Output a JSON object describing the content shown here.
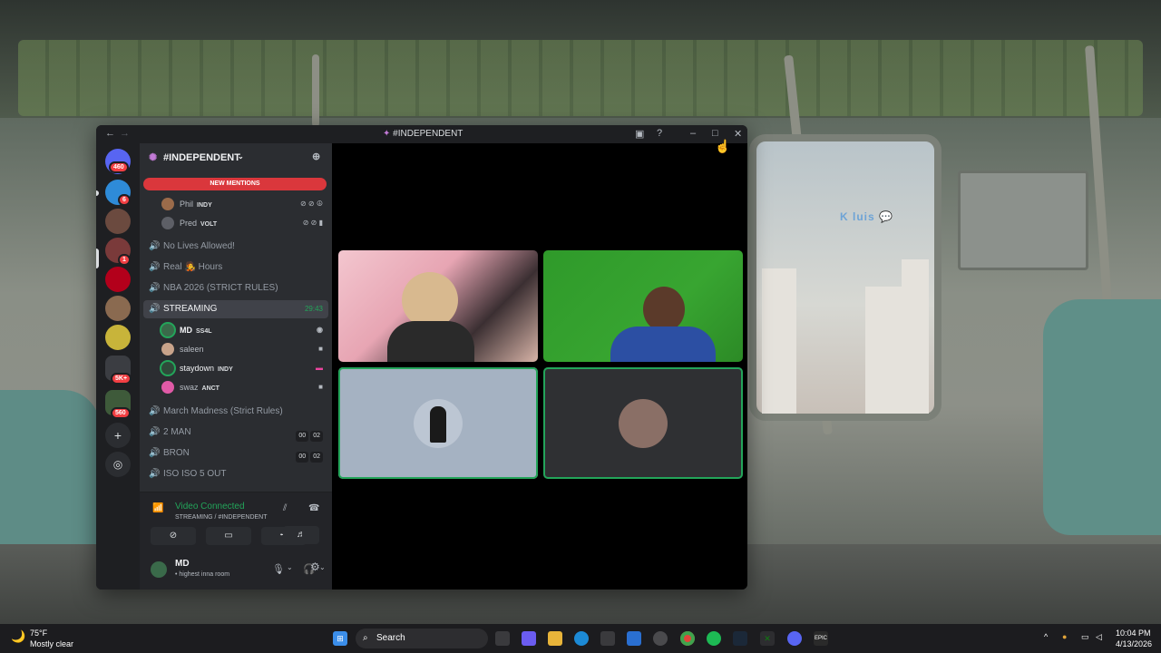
{
  "wallpaper_overlay": "luis",
  "window": {
    "title": "#INDEPENDENT",
    "back": "←",
    "forward": "→"
  },
  "rail": {
    "badges": [
      "460",
      "6",
      "1",
      "5K+",
      "560"
    ]
  },
  "server": {
    "name": "#INDEPENDENT",
    "new_mentions": "NEW MENTIONS"
  },
  "top_users": [
    {
      "name": "Phil",
      "tag": "INDY"
    },
    {
      "name": "Pred",
      "tag": "VOLT"
    }
  ],
  "channels_before": [
    {
      "name": "No Lives Allowed!"
    },
    {
      "name": "Real",
      "name_after": "Hours"
    },
    {
      "name": "NBA 2026 (STRICT RULES)"
    }
  ],
  "active_channel": {
    "name": "STREAMING",
    "timer": "29:43",
    "users": [
      {
        "name": "MD",
        "tag": "SS4L"
      },
      {
        "name": "saleen",
        "tag": ""
      },
      {
        "name": "staydown",
        "tag": "INDY"
      },
      {
        "name": "swaz",
        "tag": "ANCT"
      }
    ]
  },
  "channels_after": [
    {
      "name": "March Madness (Strict Rules)"
    },
    {
      "name": "2 MAN",
      "c1": "00",
      "c2": "02"
    },
    {
      "name": "BRON",
      "c1": "00",
      "c2": "02"
    },
    {
      "name": "ISO ISO 5 OUT"
    }
  ],
  "voice": {
    "status": "Video Connected",
    "location": "STREAMING / #INDEPENDENT"
  },
  "user_bar": {
    "name": "MD",
    "status": "• highest inna room"
  },
  "taskbar": {
    "temp": "75°F",
    "weather": "Mostly clear",
    "search": "Search",
    "time": "10:04 PM",
    "date": "4/13/2026"
  },
  "colors": {
    "accent_green": "#23a55a",
    "mention_red": "#da373c",
    "sidebar": "#2b2d31",
    "rail": "#1e1f22"
  }
}
